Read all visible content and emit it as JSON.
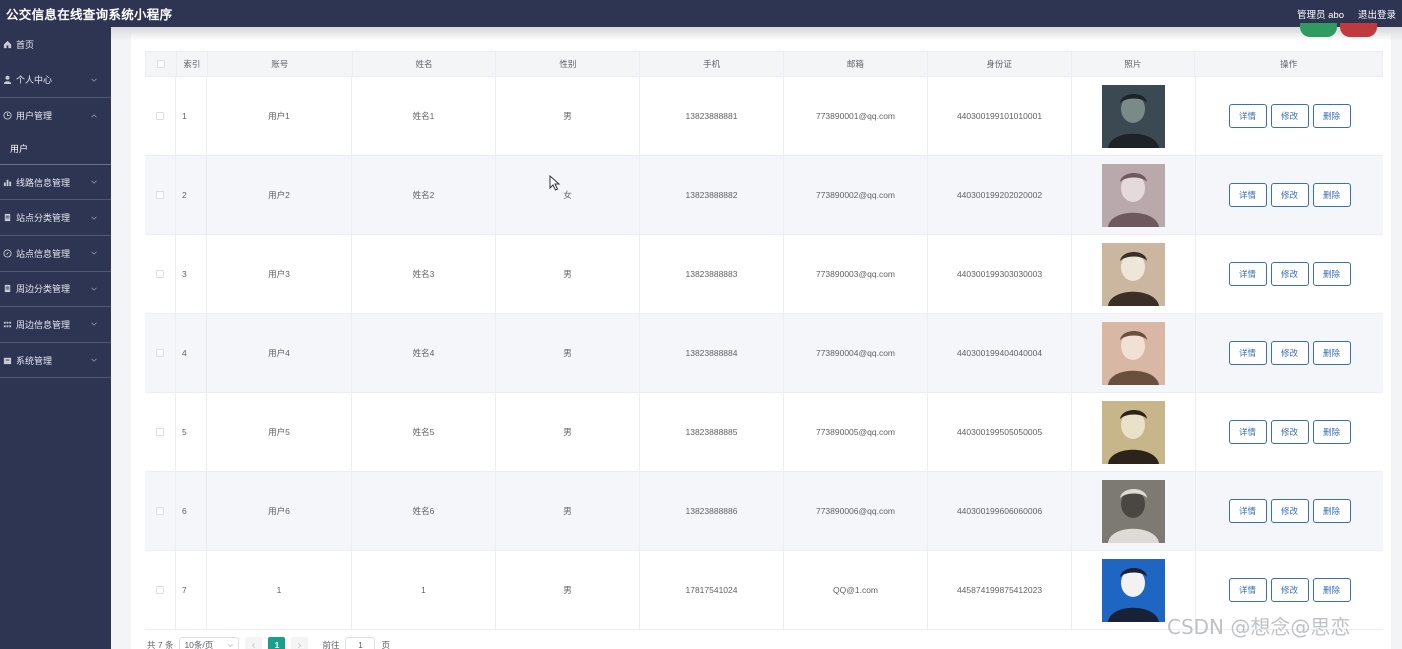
{
  "app": {
    "title": "公交信息在线查询系统小程序",
    "admin_label": "管理员 abo",
    "logout_label": "退出登录"
  },
  "sidebar": {
    "items": [
      {
        "label": "首页",
        "icon": "home-icon",
        "expandable": false
      },
      {
        "label": "个人中心",
        "icon": "user-icon",
        "expandable": true
      },
      {
        "label": "用户管理",
        "icon": "clock-icon",
        "expandable": true,
        "expanded": true
      },
      {
        "label": "线路信息管理",
        "icon": "chart-icon",
        "expandable": true
      },
      {
        "label": "站点分类管理",
        "icon": "doc-icon",
        "expandable": true
      },
      {
        "label": "站点信息管理",
        "icon": "compass-icon",
        "expandable": true
      },
      {
        "label": "周边分类管理",
        "icon": "doc-icon",
        "expandable": true
      },
      {
        "label": "周边信息管理",
        "icon": "grid-icon",
        "expandable": true
      },
      {
        "label": "系统管理",
        "icon": "box-icon",
        "expandable": true
      }
    ],
    "submenu_user": "用户"
  },
  "table": {
    "headers": [
      "索引",
      "账号",
      "姓名",
      "性别",
      "手机",
      "邮箱",
      "身份证",
      "照片",
      "操作"
    ],
    "rows": [
      {
        "idx": "1",
        "account": "用户1",
        "name": "姓名1",
        "sex": "男",
        "phone": "13823888881",
        "email": "773890001@qq.com",
        "id_card": "440300199101010001"
      },
      {
        "idx": "2",
        "account": "用户2",
        "name": "姓名2",
        "sex": "女",
        "phone": "13823888882",
        "email": "773890002@qq.com",
        "id_card": "440300199202020002"
      },
      {
        "idx": "3",
        "account": "用户3",
        "name": "姓名3",
        "sex": "男",
        "phone": "13823888883",
        "email": "773890003@qq.com",
        "id_card": "440300199303030003"
      },
      {
        "idx": "4",
        "account": "用户4",
        "name": "姓名4",
        "sex": "男",
        "phone": "13823888884",
        "email": "773890004@qq.com",
        "id_card": "440300199404040004"
      },
      {
        "idx": "5",
        "account": "用户5",
        "name": "姓名5",
        "sex": "男",
        "phone": "13823888885",
        "email": "773890005@qq.com",
        "id_card": "440300199505050005"
      },
      {
        "idx": "6",
        "account": "用户6",
        "name": "姓名6",
        "sex": "男",
        "phone": "13823888886",
        "email": "773890006@qq.com",
        "id_card": "440300199606060006"
      },
      {
        "idx": "7",
        "account": "1",
        "name": "1",
        "sex": "男",
        "phone": "17817541024",
        "email": "QQ@1.com",
        "id_card": "445874199875412023"
      }
    ],
    "actions": {
      "detail": "详情",
      "edit": "修改",
      "delete": "删除"
    }
  },
  "pagination": {
    "total_text": "共 7 条",
    "page_size": "10条/页",
    "current_page": "1",
    "goto_label": "前往",
    "goto_value": "1",
    "page_suffix": "页"
  },
  "watermark": "CSDN @想念@思恋",
  "colors": {
    "sidebar_bg": "#2e3552",
    "accent_teal": "#1aa08a",
    "action_blue": "#3a6fb5",
    "btn_green": "#2f9b60",
    "btn_red": "#c0393f"
  }
}
